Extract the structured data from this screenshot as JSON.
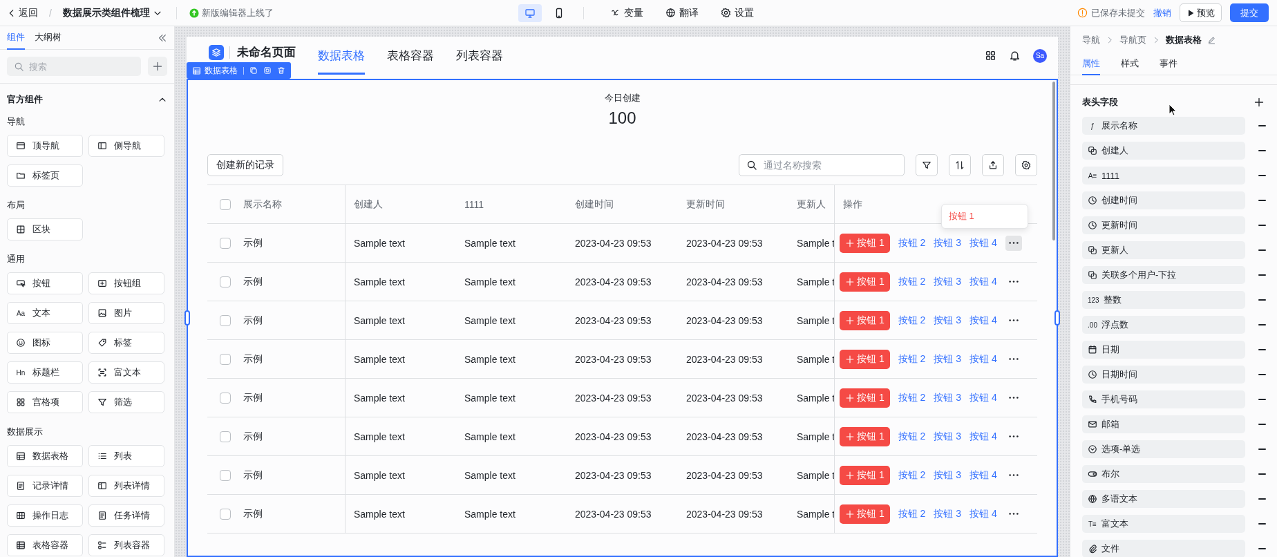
{
  "topbar": {
    "back": "返回",
    "separator": "/",
    "project": "数据展示类组件梳理",
    "notice": "新版编辑器上线了",
    "devices": [
      {
        "kind": "desktop",
        "selected": true
      },
      {
        "kind": "mobile",
        "selected": false
      }
    ],
    "tools": [
      {
        "kind": "variable",
        "label": "变量"
      },
      {
        "kind": "globe",
        "label": "翻译"
      },
      {
        "kind": "gear",
        "label": "设置"
      }
    ],
    "save_status": "已保存未提交",
    "undo": "撤销",
    "preview": "预览",
    "submit": "提交"
  },
  "left_panel": {
    "tabs": [
      {
        "label": "组件",
        "selected": true
      },
      {
        "label": "大纲树",
        "selected": false
      }
    ],
    "search": {
      "placeholder": "搜索"
    },
    "section": {
      "title": "官方组件",
      "expanded": true,
      "groups": [
        {
          "title": "导航",
          "items": [
            {
              "label": "顶导航",
              "kind": "topnav"
            },
            {
              "label": "侧导航",
              "kind": "sidenav"
            },
            {
              "label": "标签页",
              "kind": "folder"
            }
          ]
        },
        {
          "title": "布局",
          "items": [
            {
              "label": "区块",
              "kind": "block"
            }
          ]
        },
        {
          "title": "通用",
          "items": [
            {
              "label": "按钮",
              "kind": "button"
            },
            {
              "label": "按钮组",
              "kind": "buttongroup"
            },
            {
              "label": "文本",
              "kind": "glyph",
              "icon_text": "Aa"
            },
            {
              "label": "图片",
              "kind": "image"
            },
            {
              "label": "图标",
              "kind": "smile"
            },
            {
              "label": "标签",
              "kind": "tag"
            },
            {
              "label": "标题栏",
              "kind": "glyph",
              "icon_text": "Hn"
            },
            {
              "label": "富文本",
              "kind": "scan"
            },
            {
              "label": "宫格项",
              "kind": "grid4"
            },
            {
              "label": "筛选",
              "kind": "filter"
            }
          ]
        },
        {
          "title": "数据展示",
          "items": [
            {
              "label": "数据表格",
              "kind": "table"
            },
            {
              "label": "列表",
              "kind": "list"
            },
            {
              "label": "记录详情",
              "kind": "record"
            },
            {
              "label": "列表详情",
              "kind": "listdetail"
            },
            {
              "label": "操作日志",
              "kind": "log"
            },
            {
              "label": "任务详情",
              "kind": "record"
            },
            {
              "label": "表格容器",
              "kind": "tablebox"
            },
            {
              "label": "列表容器",
              "kind": "listbox"
            }
          ]
        }
      ]
    }
  },
  "canvas": {
    "page_title": "未命名页面",
    "nav_tabs": [
      {
        "label": "数据表格",
        "selected": true
      },
      {
        "label": "表格容器",
        "selected": false
      },
      {
        "label": "列表容器",
        "selected": false
      }
    ],
    "avatar": "Sa",
    "selection": {
      "label": "数据表格"
    },
    "stat": {
      "label": "今日创建",
      "value": "100"
    },
    "create_button": "创建新的记录",
    "search": {
      "placeholder": "通过名称搜索"
    },
    "table": {
      "header_checked": false,
      "columns": [
        "展示名称",
        "创建人",
        "1111",
        "创建时间",
        "更新时间",
        "更新人",
        "操作"
      ],
      "rows": [
        {
          "checked": false,
          "more_active": true,
          "cells": [
            "示例",
            "Sample text",
            "Sample text",
            "2023-04-23 09:53",
            "2023-04-23 09:53",
            "Sample t"
          ],
          "actions": [
            "按钮 1",
            "按钮 2",
            "按钮 3",
            "按钮 4"
          ]
        },
        {
          "checked": false,
          "more_active": false,
          "cells": [
            "示例",
            "Sample text",
            "Sample text",
            "2023-04-23 09:53",
            "2023-04-23 09:53",
            "Sample t"
          ],
          "actions": [
            "按钮 1",
            "按钮 2",
            "按钮 3",
            "按钮 4"
          ]
        },
        {
          "checked": false,
          "more_active": false,
          "cells": [
            "示例",
            "Sample text",
            "Sample text",
            "2023-04-23 09:53",
            "2023-04-23 09:53",
            "Sample t"
          ],
          "actions": [
            "按钮 1",
            "按钮 2",
            "按钮 3",
            "按钮 4"
          ]
        },
        {
          "checked": false,
          "more_active": false,
          "cells": [
            "示例",
            "Sample text",
            "Sample text",
            "2023-04-23 09:53",
            "2023-04-23 09:53",
            "Sample t"
          ],
          "actions": [
            "按钮 1",
            "按钮 2",
            "按钮 3",
            "按钮 4"
          ]
        },
        {
          "checked": false,
          "more_active": false,
          "cells": [
            "示例",
            "Sample text",
            "Sample text",
            "2023-04-23 09:53",
            "2023-04-23 09:53",
            "Sample t"
          ],
          "actions": [
            "按钮 1",
            "按钮 2",
            "按钮 3",
            "按钮 4"
          ]
        },
        {
          "checked": false,
          "more_active": false,
          "cells": [
            "示例",
            "Sample text",
            "Sample text",
            "2023-04-23 09:53",
            "2023-04-23 09:53",
            "Sample t"
          ],
          "actions": [
            "按钮 1",
            "按钮 2",
            "按钮 3",
            "按钮 4"
          ]
        },
        {
          "checked": false,
          "more_active": false,
          "cells": [
            "示例",
            "Sample text",
            "Sample text",
            "2023-04-23 09:53",
            "2023-04-23 09:53",
            "Sample t"
          ],
          "actions": [
            "按钮 1",
            "按钮 2",
            "按钮 3",
            "按钮 4"
          ]
        },
        {
          "checked": false,
          "more_active": false,
          "cells": [
            "示例",
            "Sample text",
            "Sample text",
            "2023-04-23 09:53",
            "2023-04-23 09:53",
            "Sample t"
          ],
          "actions": [
            "按钮 1",
            "按钮 2",
            "按钮 3",
            "按钮 4"
          ]
        }
      ]
    },
    "popover": {
      "label": "按钮 1"
    }
  },
  "right_panel": {
    "breadcrumb": [
      "导航",
      "导航页",
      "数据表格"
    ],
    "tabs": [
      {
        "label": "属性",
        "selected": true
      },
      {
        "label": "样式",
        "selected": false
      },
      {
        "label": "事件",
        "selected": false
      }
    ],
    "section_title": "表头字段",
    "fields": [
      {
        "label": "展示名称",
        "kind": "glyph",
        "icon_text": "ƒ"
      },
      {
        "label": "创建人",
        "kind": "link"
      },
      {
        "label": "1111",
        "kind": "glyph",
        "icon_text": "A≡"
      },
      {
        "label": "创建时间",
        "kind": "clock"
      },
      {
        "label": "更新时间",
        "kind": "clock"
      },
      {
        "label": "更新人",
        "kind": "link"
      },
      {
        "label": "关联多个用户-下拉",
        "kind": "link"
      },
      {
        "label": "整数",
        "kind": "glyph",
        "icon_text": "123"
      },
      {
        "label": "浮点数",
        "kind": "glyph",
        "icon_text": ".00"
      },
      {
        "label": "日期",
        "kind": "calendar"
      },
      {
        "label": "日期时间",
        "kind": "clock"
      },
      {
        "label": "手机号码",
        "kind": "phone"
      },
      {
        "label": "邮箱",
        "kind": "mail"
      },
      {
        "label": "选项-单选",
        "kind": "select"
      },
      {
        "label": "布尔",
        "kind": "toggle"
      },
      {
        "label": "多语文本",
        "kind": "globe"
      },
      {
        "label": "富文本",
        "kind": "glyph",
        "icon_text": "T≡"
      },
      {
        "label": "文件",
        "kind": "clip"
      }
    ]
  }
}
